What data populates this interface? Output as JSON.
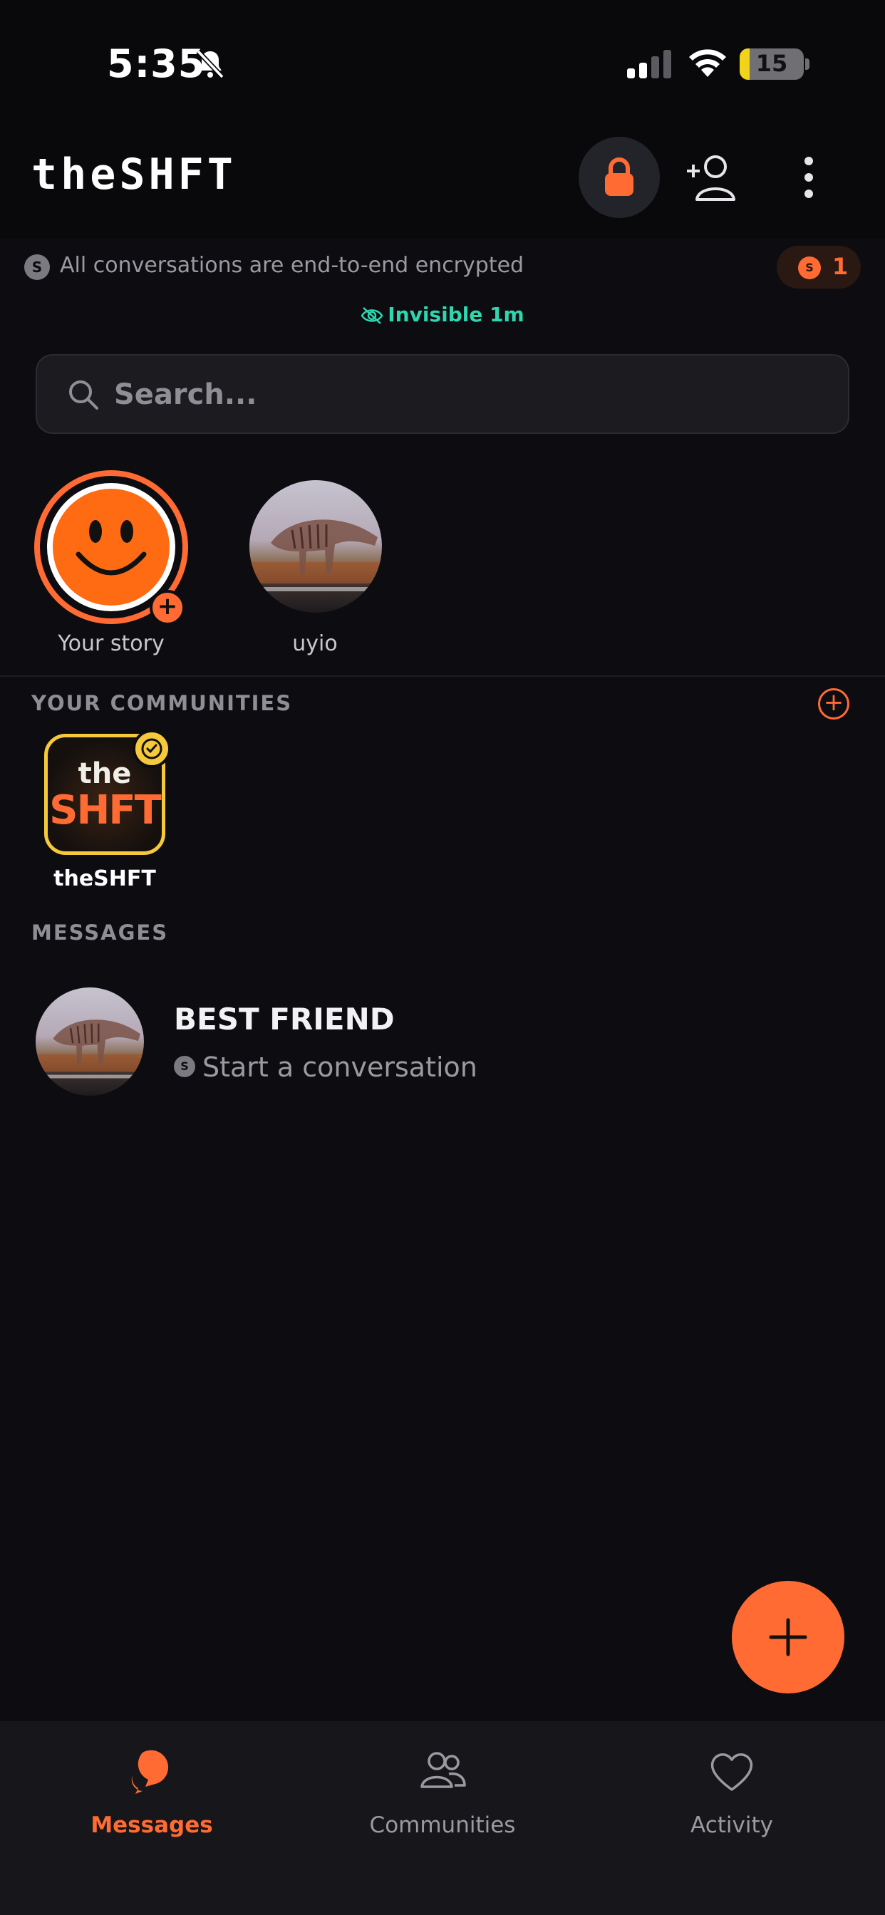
{
  "status_bar": {
    "time": "5:35",
    "battery": "15",
    "battery_level": 0.15
  },
  "header": {
    "title": "theSHFT"
  },
  "encryption": {
    "badge": "S",
    "text": "All conversations are end-to-end encrypted",
    "coin_badge": "S",
    "coin_count": "1"
  },
  "presence": {
    "text": "Invisible 1m"
  },
  "search": {
    "placeholder": "Search..."
  },
  "stories": [
    {
      "label": "Your story"
    },
    {
      "label": "uyio"
    }
  ],
  "communities": {
    "title": "YOUR COMMUNITIES",
    "items": [
      {
        "name": "theSHFT",
        "logo_top": "the",
        "logo_bottom": "SHFT"
      }
    ]
  },
  "messages": {
    "title": "MESSAGES",
    "items": [
      {
        "name": "BEST FRIEND",
        "badge": "S",
        "preview": "Start a conversation"
      }
    ]
  },
  "bottom_nav": [
    {
      "label": "Messages",
      "icon": "chat-bubbles-icon",
      "active": true
    },
    {
      "label": "Communities",
      "icon": "people-icon",
      "active": false
    },
    {
      "label": "Activity",
      "icon": "heart-icon",
      "active": false
    }
  ],
  "colors": {
    "accent": "#ff6b33",
    "presence": "#2fd6b0",
    "verified": "#f5c939",
    "background": "#0d0d11"
  }
}
